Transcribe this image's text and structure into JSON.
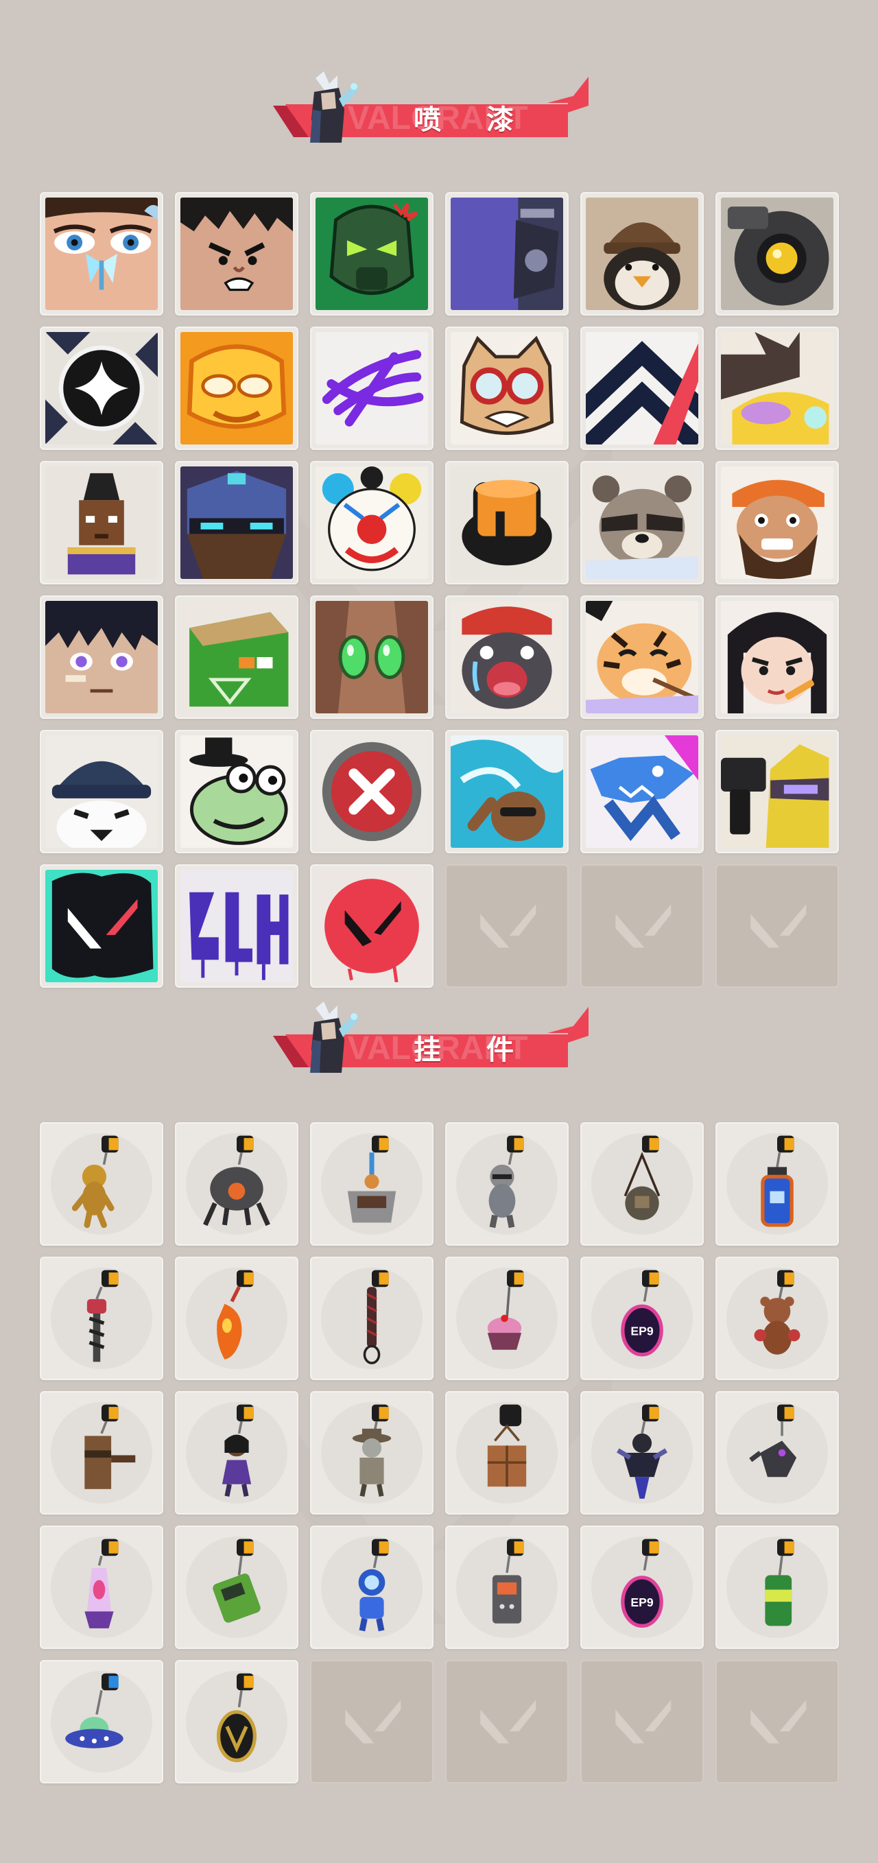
{
  "sections": {
    "sprays": {
      "title": "喷 漆",
      "banner_watermark": "VALORANT"
    },
    "charms": {
      "title": "挂 件",
      "banner_watermark": "VALORANT"
    }
  },
  "colors": {
    "background": "#cdc6c1",
    "banner_red": "#ec4455",
    "banner_dark_red": "#b7253a",
    "card": "#ebe8e4",
    "empty_card": "#c4bbb2"
  },
  "spray_icons": [
    "eyes-butterfly-spray-icon",
    "angry-boy-spray-icon",
    "green-mask-spray-icon",
    "purple-robot-spray-icon",
    "penguin-beanie-spray-icon",
    "camera-bot-spray-icon",
    "sparkle-badge-spray-icon",
    "orange-mask-spray-icon",
    "purple-scribble-spray-icon",
    "goggles-cat-spray-icon",
    "chevron-logo-spray-icon",
    "dreamy-cat-spray-icon",
    "pixel-agent-spray-icon",
    "armored-agent-spray-icon",
    "clown-spray-icon",
    "top-hat-spray-icon",
    "raccoon-spray-icon",
    "bearded-agent-spray-icon",
    "anime-boy-spray-icon",
    "green-crate-spray-icon",
    "green-eyes-spray-icon",
    "crying-seal-spray-icon",
    "tiger-spray-icon",
    "pencil-girl-spray-icon",
    "penguin-spray-icon",
    "frog-hat-spray-icon",
    "x-button-spray-icon",
    "wave-bear-spray-icon",
    "shark-spray-icon",
    "pistol-agent-spray-icon",
    "teal-v-logo-spray-icon",
    "graffiti-tag-spray-icon",
    "red-v-logo-spray-icon"
  ],
  "charm_icons": [
    "golden-bear-charm-icon",
    "drone-bot-charm-icon",
    "coffee-box-charm-icon",
    "raccoon-figure-charm-icon",
    "round-pouch-charm-icon",
    "blue-bottle-charm-icon",
    "chainsaw-charm-icon",
    "chili-pepper-charm-icon",
    "braided-cord-charm-icon",
    "cupcake-charm-icon",
    "ep9-medal-charm-icon",
    "teddy-bear-charm-icon",
    "wooden-turret-charm-icon",
    "agent-figure-charm-icon",
    "cowboy-figure-charm-icon",
    "cardboard-box-charm-icon",
    "dark-agent-charm-icon",
    "hawk-charm-icon",
    "lava-lamp-charm-icon",
    "green-pager-charm-icon",
    "astronaut-charm-icon",
    "radio-tag-charm-icon",
    "ep9-badge-charm-icon",
    "green-can-charm-icon",
    "ufo-charm-icon",
    "v-medallion-charm-icon"
  ],
  "empty_slot_icon": "valorant-v-placeholder-icon"
}
